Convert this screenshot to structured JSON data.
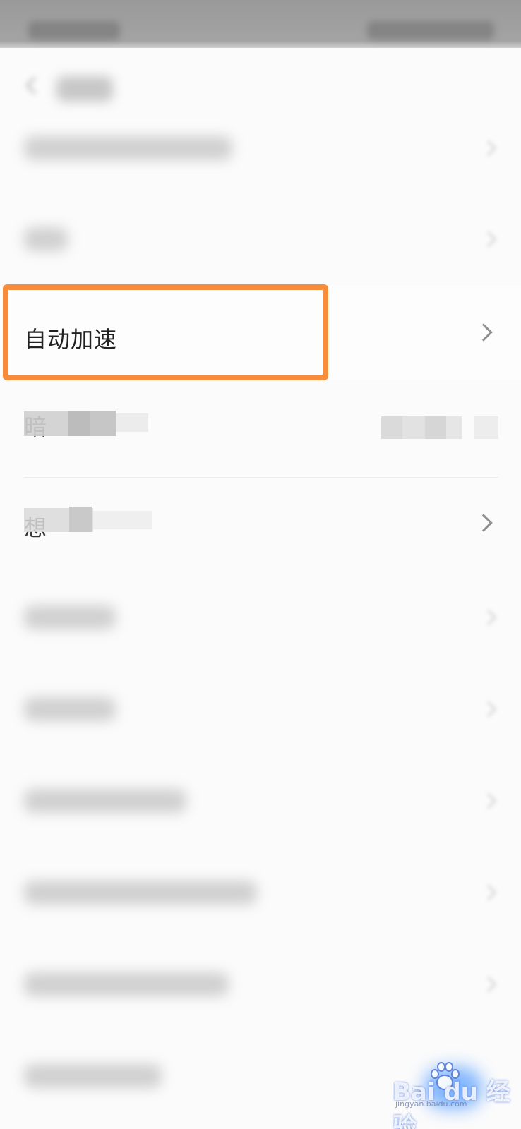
{
  "settings": {
    "highlighted_item_label": "自动加速",
    "partial_item_a": "暗",
    "partial_item_b": "想"
  },
  "watermark": {
    "brand": "Bai du 经验",
    "domain": "jingyan.baidu.com"
  },
  "colors": {
    "highlight_border": "#f78c3a",
    "chevron": "#8f8f8f",
    "background": "#fbfbfb"
  }
}
